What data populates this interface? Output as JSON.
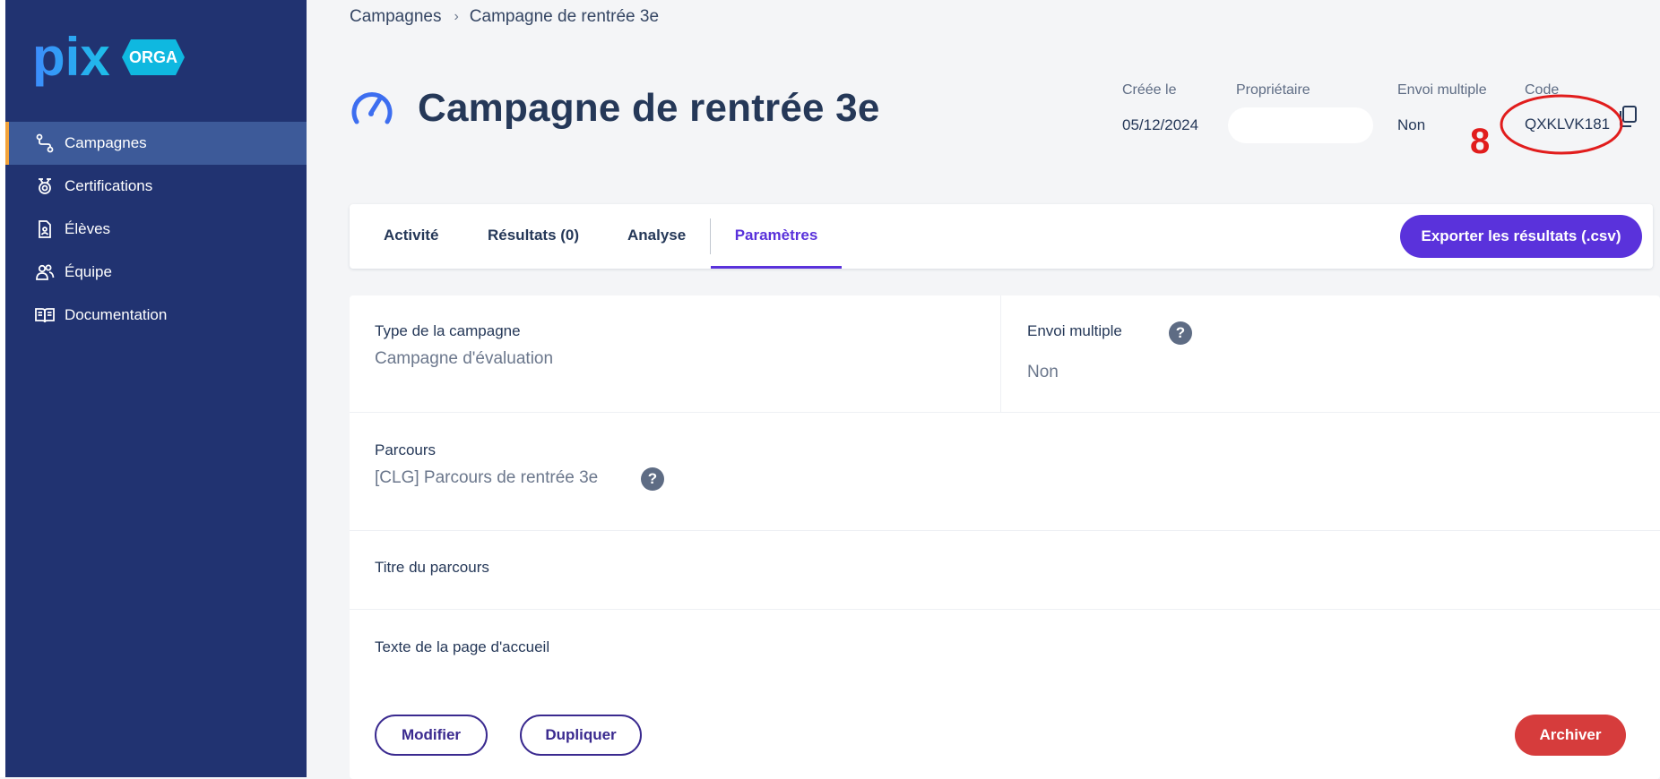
{
  "brand": {
    "logo_text": "pix",
    "logo_badge": "ORGA",
    "colors": {
      "sidebar": "#213371",
      "accent": "#5a32db",
      "danger": "#d63c3c",
      "annotation": "#e11d1d"
    }
  },
  "sidebar": {
    "items": [
      {
        "label": "Campagnes",
        "icon": "campaign-route-icon",
        "active": true
      },
      {
        "label": "Certifications",
        "icon": "certification-icon",
        "active": false
      },
      {
        "label": "Élèves",
        "icon": "student-card-icon",
        "active": false
      },
      {
        "label": "Équipe",
        "icon": "team-icon",
        "active": false
      },
      {
        "label": "Documentation",
        "icon": "book-icon",
        "active": false
      }
    ]
  },
  "breadcrumb": {
    "parent": "Campagnes",
    "current": "Campagne de rentrée 3e"
  },
  "header": {
    "title": "Campagne de rentrée 3e",
    "meta": {
      "created_label": "Créée le",
      "created_value": "05/12/2024",
      "owner_label": "Propriétaire",
      "multi_label": "Envoi multiple",
      "multi_value": "Non",
      "code_label": "Code",
      "code_value": "QXKLVK181"
    },
    "annotation_number": "8"
  },
  "tabs": [
    {
      "label": "Activité",
      "active": false
    },
    {
      "label": "Résultats (0)",
      "active": false
    },
    {
      "label": "Analyse",
      "active": false
    },
    {
      "label": "Paramètres",
      "active": true
    }
  ],
  "export_label": "Exporter les résultats (.csv)",
  "settings": {
    "type_label": "Type de la campagne",
    "type_value": "Campagne d'évaluation",
    "multi_label": "Envoi multiple",
    "multi_value": "Non",
    "parcours_label": "Parcours",
    "parcours_value": "[CLG] Parcours de rentrée 3e",
    "titre_label": "Titre du parcours",
    "texte_label": "Texte de la page d'accueil",
    "help_glyph": "?",
    "modify_label": "Modifier",
    "duplicate_label": "Dupliquer",
    "archive_label": "Archiver"
  }
}
